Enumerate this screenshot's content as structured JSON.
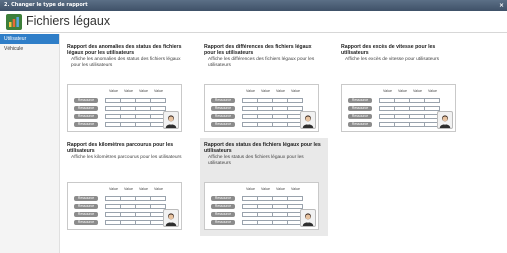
{
  "window": {
    "title": "2. Changer le type de rapport",
    "close_glyph": "×"
  },
  "header": {
    "title": "Fichiers légaux",
    "icon": "bar-chart-icon"
  },
  "sidebar": {
    "items": [
      {
        "label": "Utilisateur",
        "active": true
      },
      {
        "label": "Véhicule",
        "active": false
      }
    ]
  },
  "reports": [
    {
      "title": "Rapport des anomalies des status des fichiers légaux pour les utilisateurs",
      "description": "Affiche les anomalies des status des fichiers légaux pour les utilisateurs",
      "selected": false
    },
    {
      "title": "Rapport des différences des fichiers légaux pour les utilisateurs",
      "description": "Affiche les différences des fichiers légaux pour les utilisateurs",
      "selected": false
    },
    {
      "title": "Rapport des excès de vitesse pour les utilisateurs",
      "description": "Affiche les excès de vitesse pour utilisateurs",
      "selected": false
    },
    {
      "title": "Rapport des kilomètres parcourus pour les utilisateurs",
      "description": "Affiche les kilomètres parcourus pour les utilisateurs",
      "selected": false
    },
    {
      "title": "Rapport des status des fichiers légaux pour les utilisateurs",
      "description": "Affiche les status des fichiers légaux pour les utilisateurs",
      "selected": true
    }
  ],
  "thumbnail": {
    "column_labels": [
      "Value",
      "Value",
      "Value",
      "Value"
    ],
    "row_labels": [
      "Ressource",
      "Ressource",
      "Ressource",
      "Ressource"
    ],
    "avatar_icon": "person-icon"
  },
  "colors": {
    "accent": "#2f7ec8",
    "selected_bg": "#e9e9e9",
    "titlebar": "#4a5d75"
  }
}
